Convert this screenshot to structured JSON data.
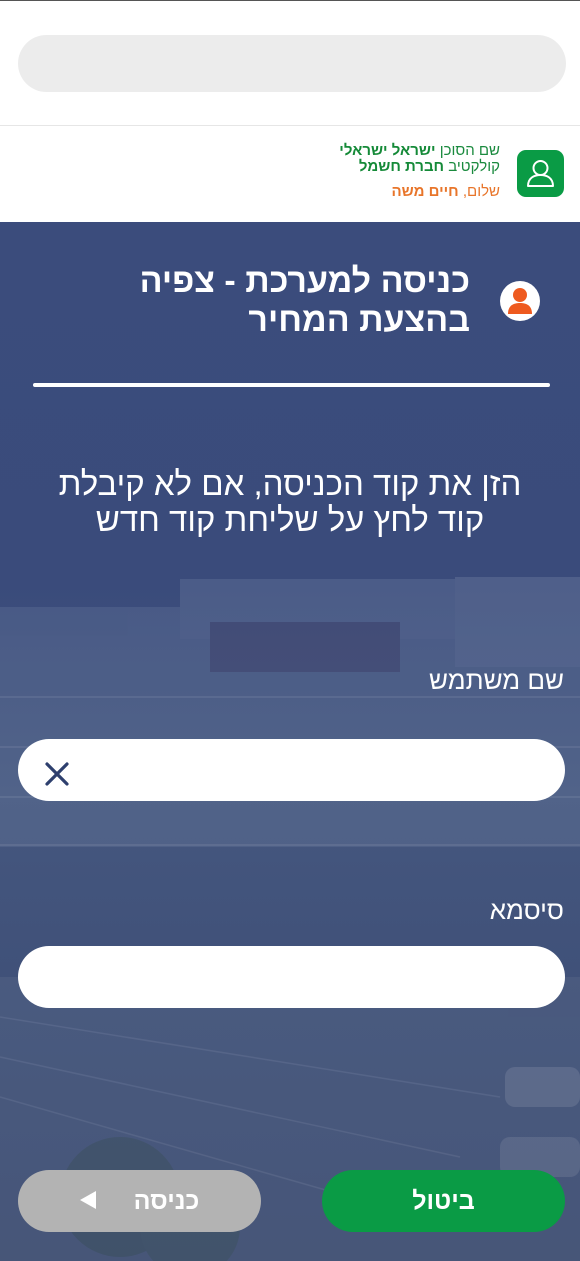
{
  "search": {
    "placeholder": "",
    "value": ""
  },
  "agent": {
    "name_prefix": "שם הסוכן",
    "name": "ישראל ישראלי",
    "collective_prefix": "קולקטיב",
    "collective": "חברת חשמל",
    "greeting_prefix": "שלום,",
    "user_name": "חיים משה"
  },
  "login": {
    "title": "כניסה למערכת - צפיה בהצעת המחיר",
    "instructions": "הזן את קוד הכניסה, אם לא קיבלת קוד לחץ על שליחת קוד חדש",
    "username_label": "שם משתמש",
    "username_value": "",
    "password_label": "סיסמא",
    "password_value": "",
    "cancel_label": "ביטול",
    "enter_label": "כניסה"
  },
  "colors": {
    "brand_green": "#0a9b45",
    "accent_orange": "#e8752a",
    "hero_blue": "#3b4c7c",
    "disabled_gray": "#b3b3b3"
  },
  "icons": {
    "agent": "user-outline-icon",
    "person": "person-icon",
    "clear": "close-icon",
    "enter_arrow": "triangle-left-icon"
  }
}
